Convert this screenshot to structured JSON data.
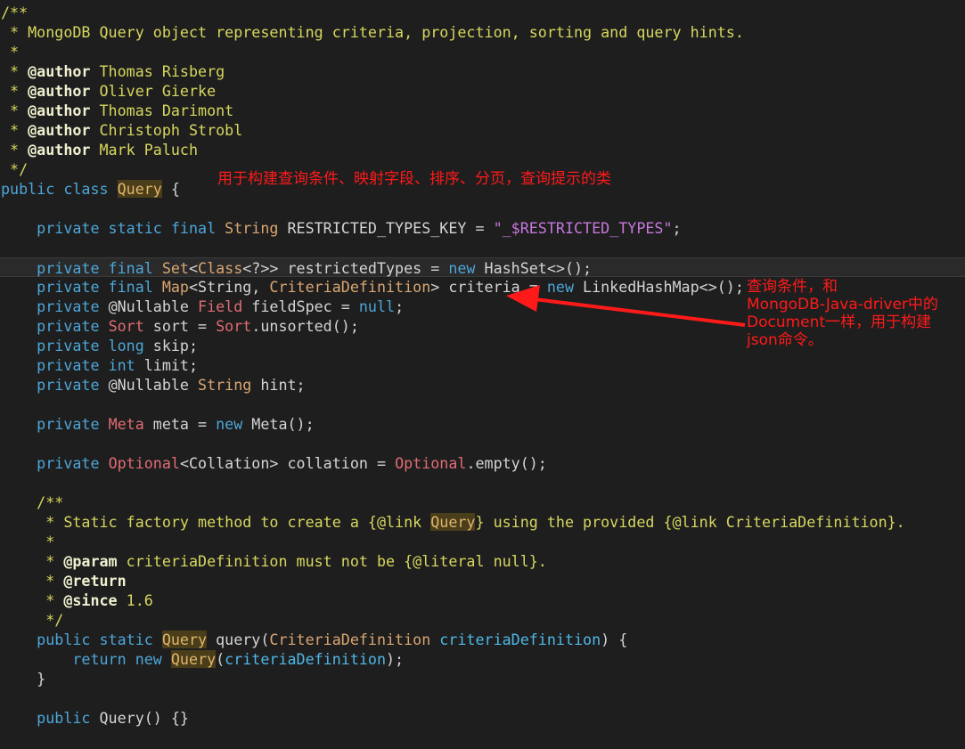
{
  "code_lines": [
    {
      "tokens": [
        {
          "t": "/**",
          "k": "comment"
        }
      ]
    },
    {
      "tokens": [
        {
          "t": " * MongoDB Query object representing criteria, projection, sorting and query hints.",
          "k": "comment"
        }
      ]
    },
    {
      "tokens": [
        {
          "t": " *",
          "k": "comment"
        }
      ]
    },
    {
      "tokens": [
        {
          "t": " * ",
          "k": "comment"
        },
        {
          "t": "@author",
          "k": "tag"
        },
        {
          "t": " Thomas Risberg",
          "k": "comment"
        }
      ]
    },
    {
      "tokens": [
        {
          "t": " * ",
          "k": "comment"
        },
        {
          "t": "@author",
          "k": "tag"
        },
        {
          "t": " Oliver Gierke",
          "k": "comment"
        }
      ]
    },
    {
      "tokens": [
        {
          "t": " * ",
          "k": "comment"
        },
        {
          "t": "@author",
          "k": "tag"
        },
        {
          "t": " Thomas Darimont",
          "k": "comment"
        }
      ]
    },
    {
      "tokens": [
        {
          "t": " * ",
          "k": "comment"
        },
        {
          "t": "@author",
          "k": "tag"
        },
        {
          "t": " Christoph Strobl",
          "k": "comment"
        }
      ]
    },
    {
      "tokens": [
        {
          "t": " * ",
          "k": "comment"
        },
        {
          "t": "@author",
          "k": "tag"
        },
        {
          "t": " Mark Paluch",
          "k": "comment"
        }
      ]
    },
    {
      "tokens": [
        {
          "t": " */",
          "k": "comment"
        }
      ]
    },
    {
      "tokens": [
        {
          "t": "public class ",
          "k": "kw"
        },
        {
          "t": "Query",
          "k": "hl"
        },
        {
          "t": " {",
          "k": "ident"
        }
      ]
    },
    {
      "tokens": []
    },
    {
      "tokens": [
        {
          "t": "    private static final ",
          "k": "kw"
        },
        {
          "t": "String",
          "k": "type"
        },
        {
          "t": " RESTRICTED_TYPES_KEY = ",
          "k": "ident"
        },
        {
          "t": "\"_$RESTRICTED_TYPES\"",
          "k": "str"
        },
        {
          "t": ";",
          "k": "ident"
        }
      ]
    },
    {
      "tokens": []
    },
    {
      "current": true,
      "tokens": [
        {
          "t": "    private final ",
          "k": "kw"
        },
        {
          "t": "Set",
          "k": "type"
        },
        {
          "t": "<",
          "k": "ident"
        },
        {
          "t": "Class",
          "k": "type"
        },
        {
          "t": "<?>> restrictedTypes = ",
          "k": "ident"
        },
        {
          "t": "new",
          "k": "kw"
        },
        {
          "t": " HashSet<>();",
          "k": "ident"
        }
      ]
    },
    {
      "tokens": [
        {
          "t": "    private final ",
          "k": "kw"
        },
        {
          "t": "Map",
          "k": "type"
        },
        {
          "t": "<String, ",
          "k": "ident"
        },
        {
          "t": "CriteriaDefinition",
          "k": "type"
        },
        {
          "t": "> criteria = ",
          "k": "ident"
        },
        {
          "t": "new",
          "k": "kw"
        },
        {
          "t": " LinkedHashMap<>();",
          "k": "ident"
        }
      ]
    },
    {
      "tokens": [
        {
          "t": "    private ",
          "k": "kw"
        },
        {
          "t": "@Nullable ",
          "k": "annot"
        },
        {
          "t": "Field",
          "k": "cls"
        },
        {
          "t": " fieldSpec = ",
          "k": "ident"
        },
        {
          "t": "null",
          "k": "kw"
        },
        {
          "t": ";",
          "k": "ident"
        }
      ]
    },
    {
      "tokens": [
        {
          "t": "    private ",
          "k": "kw"
        },
        {
          "t": "Sort",
          "k": "cls"
        },
        {
          "t": " sort = ",
          "k": "ident"
        },
        {
          "t": "Sort",
          "k": "cls"
        },
        {
          "t": ".unsorted();",
          "k": "ident"
        }
      ]
    },
    {
      "tokens": [
        {
          "t": "    private long ",
          "k": "kw"
        },
        {
          "t": "skip;",
          "k": "ident"
        }
      ]
    },
    {
      "tokens": [
        {
          "t": "    private int ",
          "k": "kw"
        },
        {
          "t": "limit;",
          "k": "ident"
        }
      ]
    },
    {
      "tokens": [
        {
          "t": "    private ",
          "k": "kw"
        },
        {
          "t": "@Nullable ",
          "k": "annot"
        },
        {
          "t": "String",
          "k": "type"
        },
        {
          "t": " hint;",
          "k": "ident"
        }
      ]
    },
    {
      "tokens": []
    },
    {
      "tokens": [
        {
          "t": "    private ",
          "k": "kw"
        },
        {
          "t": "Meta",
          "k": "cls"
        },
        {
          "t": " meta = ",
          "k": "ident"
        },
        {
          "t": "new",
          "k": "kw"
        },
        {
          "t": " Meta();",
          "k": "ident"
        }
      ]
    },
    {
      "tokens": []
    },
    {
      "tokens": [
        {
          "t": "    private ",
          "k": "kw"
        },
        {
          "t": "Optional",
          "k": "cls"
        },
        {
          "t": "<Collation> collation = ",
          "k": "ident"
        },
        {
          "t": "Optional",
          "k": "cls"
        },
        {
          "t": ".empty();",
          "k": "ident"
        }
      ]
    },
    {
      "tokens": []
    },
    {
      "tokens": [
        {
          "t": "    /**",
          "k": "comment"
        }
      ]
    },
    {
      "tokens": [
        {
          "t": "     * Static factory method to create a {@link ",
          "k": "comment"
        },
        {
          "t": "Query",
          "k": "hl"
        },
        {
          "t": "} using the provided {@link CriteriaDefinition}.",
          "k": "comment"
        }
      ]
    },
    {
      "tokens": [
        {
          "t": "     *",
          "k": "comment"
        }
      ]
    },
    {
      "tokens": [
        {
          "t": "     * ",
          "k": "comment"
        },
        {
          "t": "@param",
          "k": "tag"
        },
        {
          "t": " criteriaDefinition must not be {@literal null}.",
          "k": "comment"
        }
      ]
    },
    {
      "tokens": [
        {
          "t": "     * ",
          "k": "comment"
        },
        {
          "t": "@return",
          "k": "tag"
        }
      ]
    },
    {
      "tokens": [
        {
          "t": "     * ",
          "k": "comment"
        },
        {
          "t": "@since",
          "k": "tag"
        },
        {
          "t": " 1.6",
          "k": "comment"
        }
      ]
    },
    {
      "tokens": [
        {
          "t": "     */",
          "k": "comment"
        }
      ]
    },
    {
      "tokens": [
        {
          "t": "    public static ",
          "k": "kw"
        },
        {
          "t": "Query",
          "k": "hl"
        },
        {
          "t": " query(",
          "k": "ident"
        },
        {
          "t": "CriteriaDefinition",
          "k": "type"
        },
        {
          "t": " ",
          "k": "ident"
        },
        {
          "t": "criteriaDefinition",
          "k": "param"
        },
        {
          "t": ") {",
          "k": "ident"
        }
      ]
    },
    {
      "tokens": [
        {
          "t": "        return new ",
          "k": "kw"
        },
        {
          "t": "Query",
          "k": "hl"
        },
        {
          "t": "(",
          "k": "ident"
        },
        {
          "t": "criteriaDefinition",
          "k": "param"
        },
        {
          "t": ");",
          "k": "ident"
        }
      ]
    },
    {
      "tokens": [
        {
          "t": "    }",
          "k": "ident"
        }
      ]
    },
    {
      "tokens": []
    },
    {
      "tokens": [
        {
          "t": "    public ",
          "k": "kw"
        },
        {
          "t": "Query() {}",
          "k": "ident"
        }
      ]
    }
  ],
  "annotations": {
    "class_note": "用于构建查询条件、映射字段、排序、分页，查询提示的类",
    "criteria_note": "查询条件，和\nMongoDB-Java-driver中的\nDocument一样，用于构建\njson命令。"
  },
  "colors": {
    "background": "#1e1e1e",
    "comment": "#d7d75f",
    "keyword": "#4da6d8",
    "type": "#d9a672",
    "class_ref": "#e06c75",
    "string": "#c678dd",
    "annotation_red": "#ff1a1a"
  }
}
